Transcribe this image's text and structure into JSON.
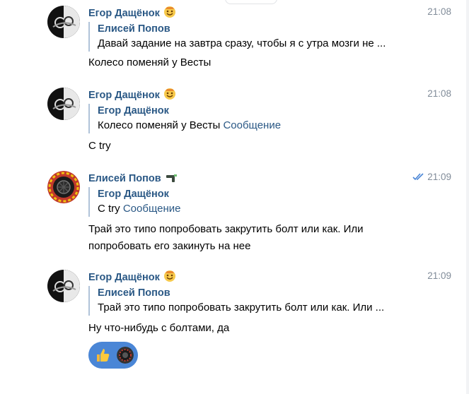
{
  "messages": [
    {
      "author": "Егор Дащёнок",
      "time": "21:08",
      "reply_author": "Елисей Попов",
      "reply_text": "Давай задание на завтра сразу, чтобы я с утра мозги не ...",
      "reply_link": "",
      "text": "Колесо поменяй у Весты"
    },
    {
      "author": "Егор Дащёнок",
      "time": "21:08",
      "reply_author": "Егор Дащёнок",
      "reply_text": "Колесо поменяй у Весты",
      "reply_link": "Сообщение",
      "text": "С try"
    },
    {
      "author": "Елисей Попов",
      "time": "21:09",
      "read": true,
      "reply_author": "Егор Дащёнок",
      "reply_text": "С try",
      "reply_link": "Сообщение",
      "text_line1": "Трай это типо попробовать закрутить болт или как. Или",
      "text_line2": "попробовать его закинуть на нее"
    },
    {
      "author": "Егор Дащёнок",
      "time": "21:09",
      "reply_author": "Елисей Попов",
      "reply_text": "Трай это типо попробовать закрутить болт или как. Или ...",
      "reply_link": "",
      "text": "Ну что-нибудь с болтами, да",
      "reactions": [
        "thumbs-up-emoji",
        "reactor-avatar"
      ]
    }
  ],
  "colors": {
    "author": "#2a5885",
    "time": "#818c99",
    "reply_bar": "#b0c3d9",
    "reaction_bg": "#4a86d6",
    "read_checks": "#4a86d6"
  }
}
